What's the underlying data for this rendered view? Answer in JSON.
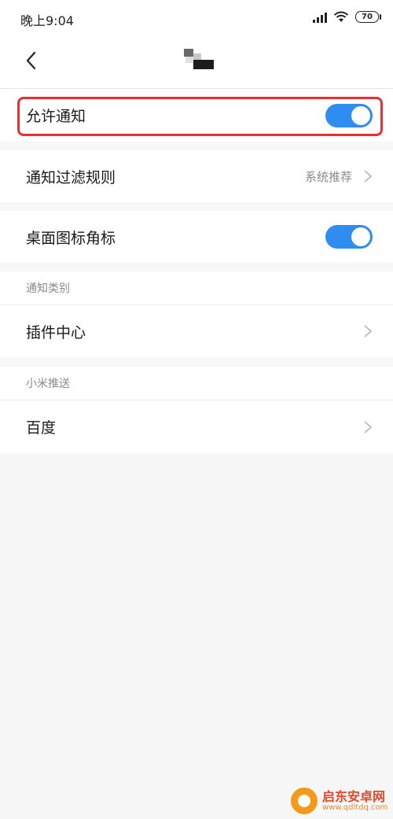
{
  "status_bar": {
    "time": "晚上9:04",
    "battery": "70"
  },
  "header": {
    "back_icon": "chevron-left-icon",
    "logo": "app-logo"
  },
  "allow_notifications": {
    "label": "允许通知",
    "enabled": true
  },
  "filter_rules": {
    "label": "通知过滤规则",
    "value": "系统推荐"
  },
  "badge": {
    "label": "桌面图标角标",
    "enabled": true
  },
  "categories": {
    "title": "通知类别",
    "items": [
      {
        "label": "插件中心"
      }
    ]
  },
  "push": {
    "title": "小米推送",
    "items": [
      {
        "label": "百度"
      }
    ]
  },
  "watermark": {
    "title": "启东安卓网",
    "url": "www.qdltdq.com"
  },
  "colors": {
    "toggle_on": "#2f8cf0",
    "highlight": "#e8312f",
    "background": "#f7f7f7"
  }
}
